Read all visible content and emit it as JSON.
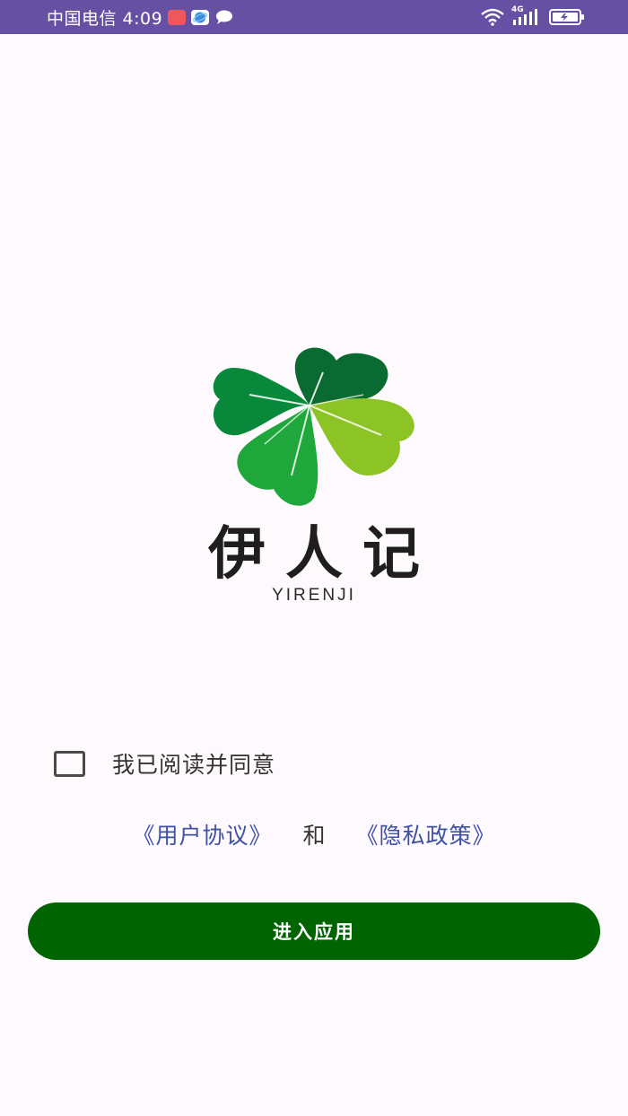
{
  "status_bar": {
    "carrier_time": "中国电信 4:09",
    "network_label": "4G",
    "background_color": "#6650A4",
    "notification_icons": [
      "app-badge-icon",
      "browser-icon",
      "message-icon"
    ]
  },
  "logo": {
    "brand_name": "伊人记",
    "brand_latin": "YIRENJI",
    "leaf_colors": [
      "#0A6B32",
      "#07883A",
      "#1FA73C",
      "#8CC425"
    ]
  },
  "agreement": {
    "checkbox_checked": false,
    "text": "我已阅读并同意",
    "user_agreement_link": "《用户协议》",
    "conjunction": "和",
    "privacy_policy_link": "《隐私政策》",
    "link_color": "#3F51A5"
  },
  "enter_button": {
    "label": "进入应用",
    "color": "#006400"
  }
}
